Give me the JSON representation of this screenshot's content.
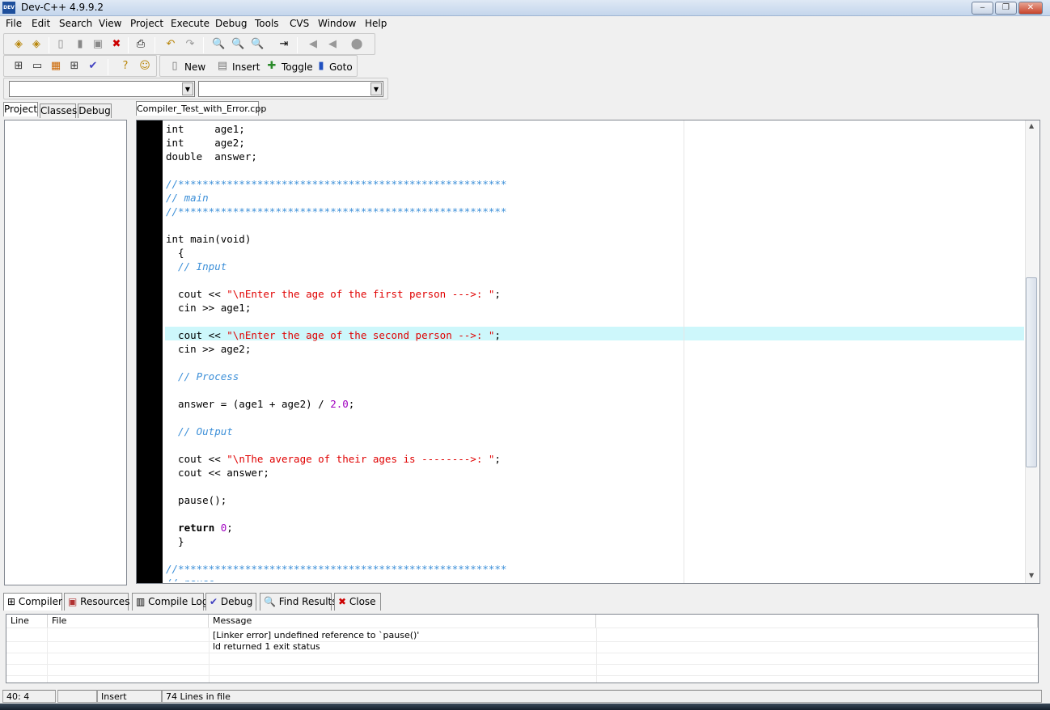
{
  "window": {
    "title": "Dev-C++ 4.9.9.2",
    "icon_text": "DEV"
  },
  "menu": [
    "File",
    "Edit",
    "Search",
    "View",
    "Project",
    "Execute",
    "Debug",
    "Tools",
    "CVS",
    "Window",
    "Help"
  ],
  "toolbar2": {
    "new_label": "New",
    "insert_label": "Insert",
    "toggle_label": "Toggle",
    "goto_label": "Goto"
  },
  "left_tabs": [
    "Project",
    "Classes",
    "Debug"
  ],
  "editor": {
    "file_tab": "Compiler_Test_with_Error.cpp",
    "lines": [
      "int     age1;",
      "int     age2;",
      "double  answer;",
      "",
      "//******************************************************",
      "// main",
      "//******************************************************",
      "",
      "int main(void)",
      "  {",
      "  // Input",
      "",
      "  cout << \"\\nEnter the age of the first person --->: \";",
      "  cin >> age1;",
      "",
      "  cout << \"\\nEnter the age of the second person -->: \";",
      "  cin >> age2;",
      "",
      "  // Process",
      "",
      "  answer = (age1 + age2) / 2.0;",
      "",
      "  // Output",
      "",
      "  cout << \"\\nThe average of their ages is -------->: \";",
      "  cout << answer;",
      "",
      "  pause();",
      "",
      "  return 0;",
      "  }",
      "",
      "//******************************************************",
      "// pause"
    ]
  },
  "bottom_tabs": [
    "Compiler",
    "Resources",
    "Compile Log",
    "Debug",
    "Find Results",
    "Close"
  ],
  "results": {
    "columns": [
      "Line",
      "File",
      "Message"
    ],
    "rows": [
      {
        "line": "",
        "file": "",
        "message": "[Linker error] undefined reference to `pause()'"
      },
      {
        "line": "",
        "file": "",
        "message": "ld returned 1 exit status"
      }
    ]
  },
  "status": {
    "position": "40: 4",
    "mode": "Insert",
    "lines": "74 Lines in file"
  },
  "colors": {
    "comment": "#3c8fd8",
    "string": "#e00000",
    "number": "#a000c0",
    "highlight": "#cdf7fb"
  }
}
